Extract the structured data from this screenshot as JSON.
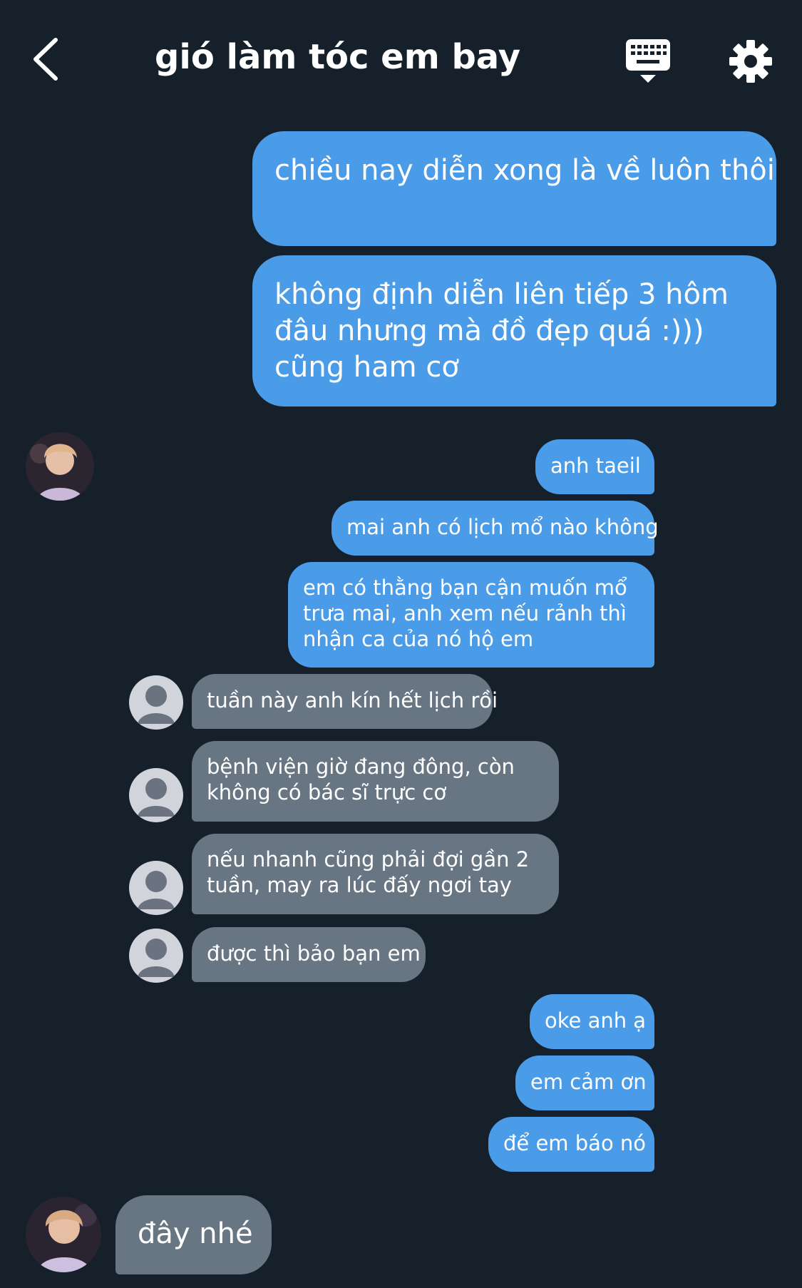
{
  "header": {
    "title": "gió làm tóc em bay",
    "back_icon": "chevron-left-icon",
    "keyboard_icon": "keyboard-hide-icon",
    "settings_icon": "gear-icon"
  },
  "colors": {
    "background": "#16202b",
    "outgoing_bubble": "#4a9ce8",
    "incoming_bubble": "#687583",
    "default_avatar": "#d1d5db"
  },
  "messages": {
    "m1": "chiều nay diễn xong là về luôn thôi",
    "m2": "không định diễn liên tiếp 3 hôm đâu nhưng mà đồ đẹp quá :))) cũng ham cơ",
    "m3": "anh taeil",
    "m4": "mai anh có lịch mổ nào không",
    "m5": "em có thằng bạn cận muốn mổ trưa mai, anh xem nếu rảnh thì nhận ca của nó hộ em",
    "m6": "tuần này anh kín hết lịch rồi",
    "m7": "bệnh viện giờ đang đông, còn không có bác sĩ trực cơ",
    "m8": "nếu nhanh cũng phải đợi gần 2 tuần, may ra lúc đấy ngơi tay",
    "m9": "được thì bảo bạn em",
    "m10": "oke anh ạ",
    "m11": "em cảm ơn",
    "m12": "để em báo nó",
    "m13": "đây nhé"
  }
}
